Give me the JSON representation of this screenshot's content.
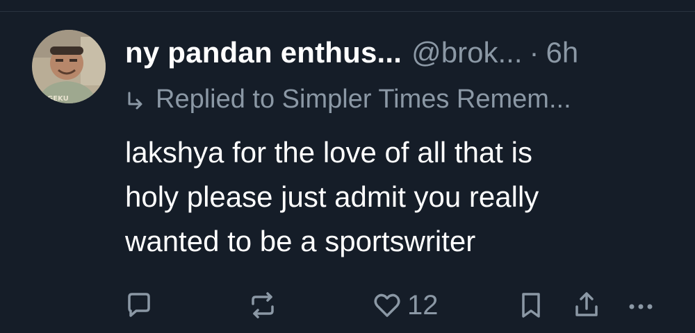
{
  "post": {
    "author": {
      "display_name": "ny pandan enthus...",
      "handle": "@brok...",
      "separator": "·",
      "time": "6h",
      "avatar_shirt_text": "GEKU"
    },
    "reply_to": "Replied to Simpler Times Remem...",
    "body_lines": [
      "lakshya for the love of all that is",
      "holy please just admit you really",
      "wanted to be a sportswriter"
    ],
    "actions": {
      "like_count": "12"
    }
  },
  "colors": {
    "background": "#151d28",
    "text_primary": "#ffffff",
    "text_secondary": "#8b98a5"
  },
  "icons": [
    "reply-icon",
    "repost-icon",
    "like-icon",
    "bookmark-icon",
    "share-icon",
    "more-icon"
  ]
}
